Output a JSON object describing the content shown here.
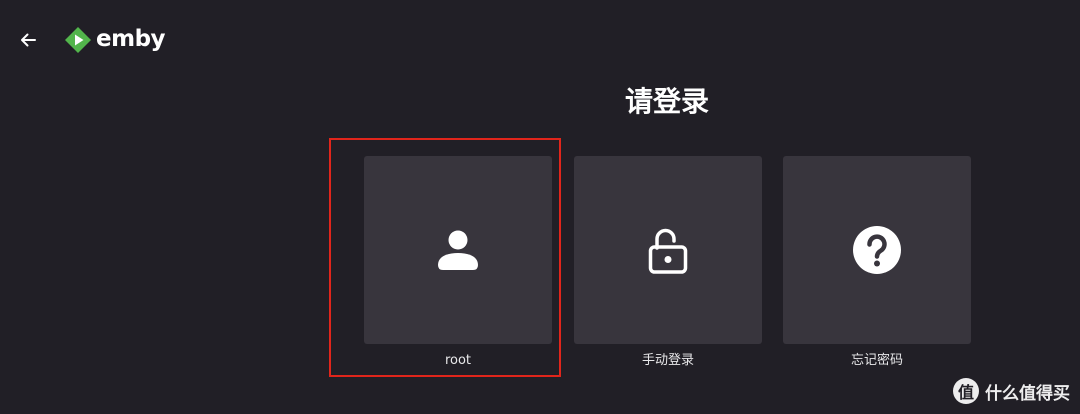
{
  "header": {
    "logo_text": "emby",
    "brand_color": "#52b54b"
  },
  "page_title": "请登录",
  "cards": [
    {
      "label": "root",
      "icon": "person-icon"
    },
    {
      "label": "手动登录",
      "icon": "unlock-icon"
    },
    {
      "label": "忘记密码",
      "icon": "help-icon"
    }
  ],
  "highlight_color": "#e1251b",
  "watermark": {
    "badge": "值",
    "text": "什么值得买"
  }
}
